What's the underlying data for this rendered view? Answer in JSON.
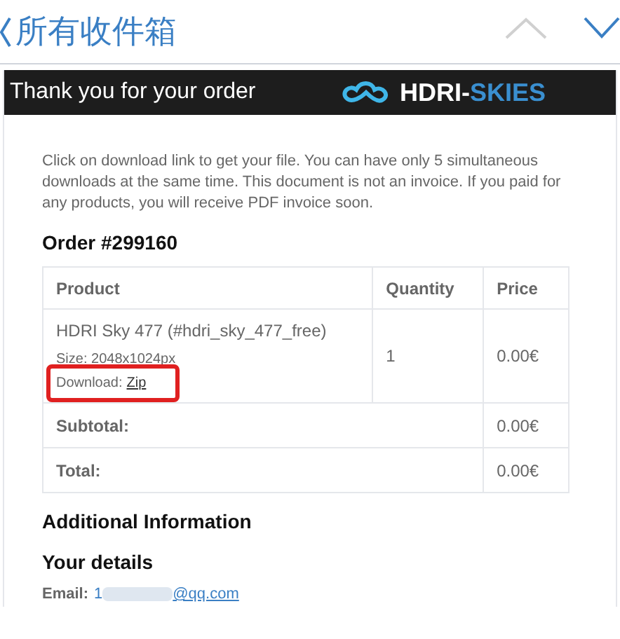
{
  "nav_bar": {
    "title": "所有收件箱"
  },
  "email": {
    "header": {
      "title": "Thank you for your order",
      "logo_text": "HDRI-",
      "logo_text_accent": "SKIES"
    },
    "intro": "Click on download link to get your file. You can have only 5 simultaneous downloads at the same time. This document is not an invoice. If you paid for any products, you will receive PDF invoice soon.",
    "order_title": "Order #299160",
    "table": {
      "columns": [
        "Product",
        "Quantity",
        "Price"
      ],
      "rows": [
        {
          "product": "HDRI Sky 477 (#hdri_sky_477_free)",
          "size": "Size: 2048x1024px",
          "download_label": "Download:",
          "download_link": "Zip",
          "highlighted": true,
          "quantity": "1",
          "price": "0.00€"
        }
      ],
      "totals": [
        {
          "label": "Subtotal:",
          "value": "0.00€"
        },
        {
          "label": "Total:",
          "value": "0.00€"
        }
      ]
    },
    "additional_title": "Additional Information",
    "details_title": "Your details",
    "email_label": "Email:",
    "email_visible_start": "1",
    "email_value": "@qq.com"
  }
}
